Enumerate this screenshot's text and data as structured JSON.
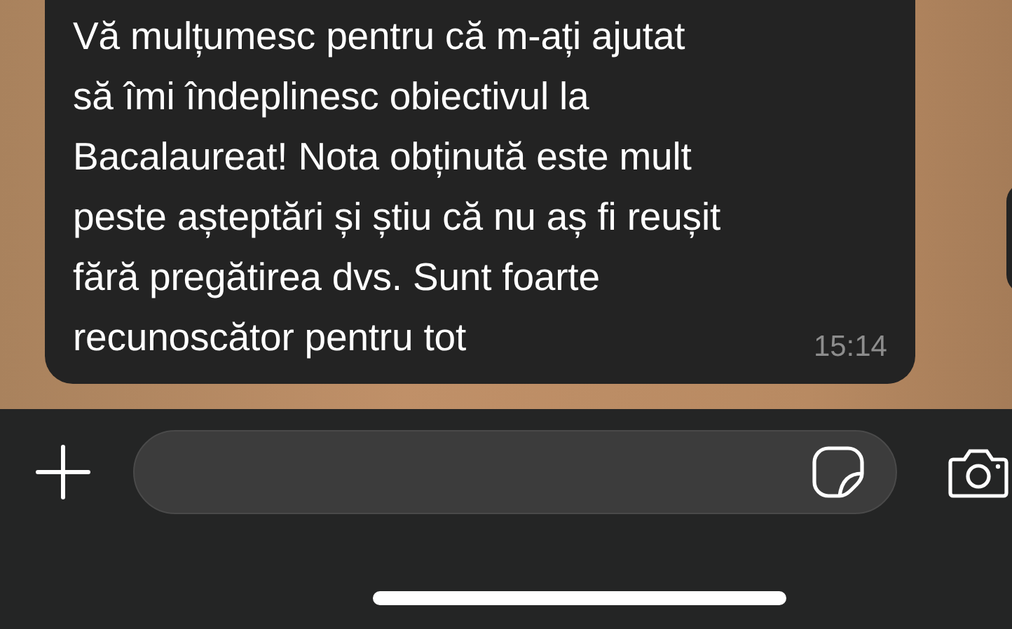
{
  "message": {
    "lines": [
      "Vă mulțumesc pentru că m-ați ajutat",
      "să îmi îndeplinesc obiectivul la",
      "Bacalaureat! Nota obținută este mult",
      "peste așteptări și știu că nu aș fi reușit",
      "fără pregătirea dvs. Sunt foarte",
      "recunoscător pentru tot"
    ],
    "time": "15:14"
  },
  "composer": {
    "kind": "empty"
  }
}
